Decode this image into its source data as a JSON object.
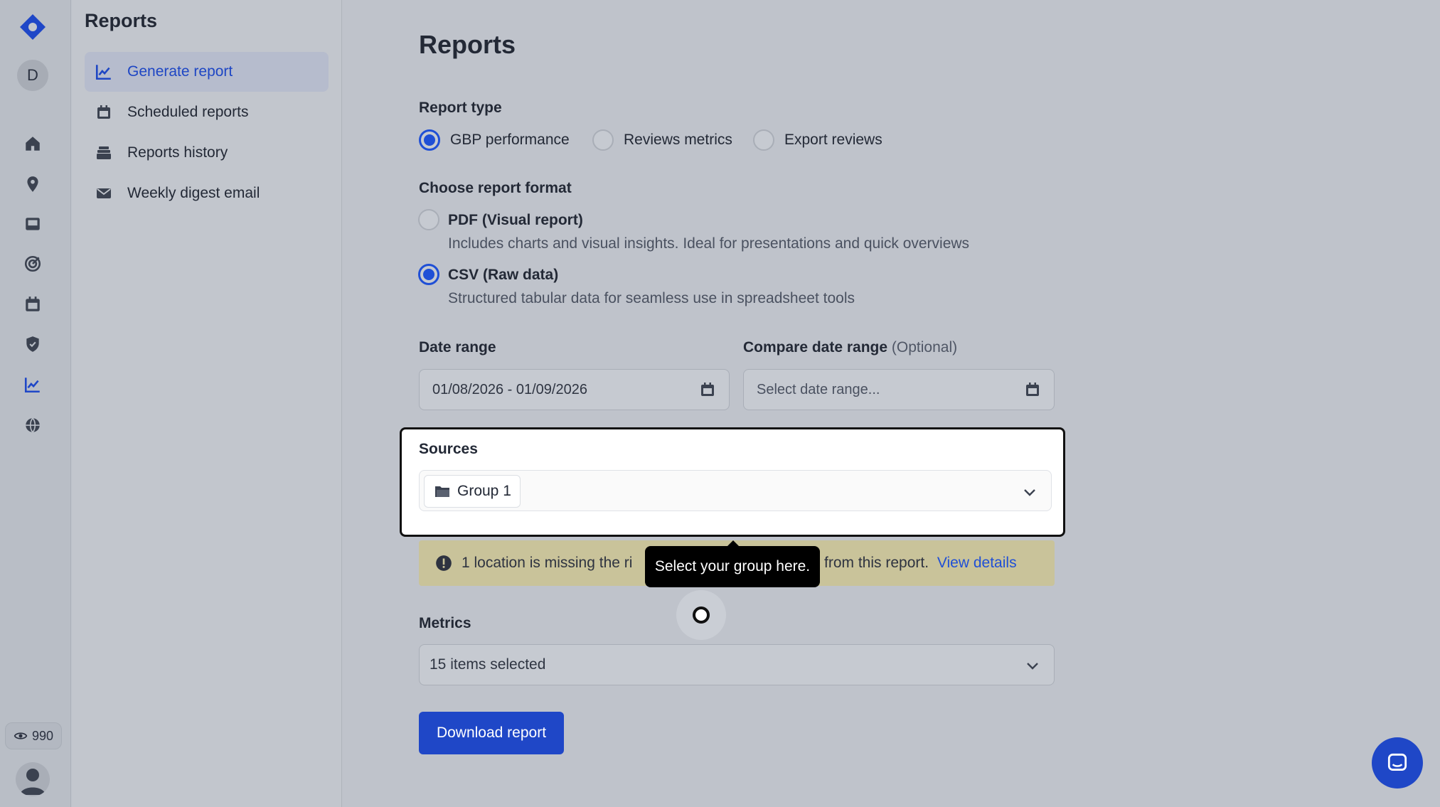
{
  "app": {
    "credits": "990",
    "avatar_initial": "D",
    "accent": "#1f47c7"
  },
  "rail": {
    "icons": [
      "logo-icon",
      "home-icon",
      "location-pin-icon",
      "inbox-icon",
      "target-icon",
      "calendar-icon",
      "shield-icon",
      "chart-line-icon",
      "globe-icon",
      "eye-icon",
      "user-icon"
    ]
  },
  "sidebar": {
    "title": "Reports",
    "items": [
      {
        "label": "Generate report",
        "icon": "chart-line-icon",
        "active": true
      },
      {
        "label": "Scheduled reports",
        "icon": "calendar-icon",
        "active": false
      },
      {
        "label": "Reports history",
        "icon": "stack-icon",
        "active": false
      },
      {
        "label": "Weekly digest email",
        "icon": "envelope-icon",
        "active": false
      }
    ]
  },
  "main": {
    "title": "Reports",
    "report_type": {
      "label": "Report type",
      "options": [
        "GBP performance",
        "Reviews metrics",
        "Export reviews"
      ],
      "selected": "GBP performance"
    },
    "format": {
      "label": "Choose report format",
      "options": [
        {
          "title": "PDF (Visual report)",
          "desc": "Includes charts and visual insights. Ideal for presentations and quick overviews"
        },
        {
          "title": "CSV (Raw data)",
          "desc": "Structured tabular data for seamless use in spreadsheet tools"
        }
      ],
      "selected": "CSV (Raw data)"
    },
    "date_range": {
      "label": "Date range",
      "value": "01/08/2026 - 01/09/2026"
    },
    "compare_range": {
      "label": "Compare date range",
      "optional": "(Optional)",
      "placeholder": "Select date range..."
    },
    "sources": {
      "label": "Sources",
      "chip": "Group 1"
    },
    "warning": {
      "text_left": "1 location is missing the ri",
      "text_right": "from this report.",
      "link": "View details"
    },
    "tooltip": "Select your group here.",
    "metrics": {
      "label": "Metrics",
      "value": "15 items selected"
    },
    "download_button": "Download report"
  }
}
